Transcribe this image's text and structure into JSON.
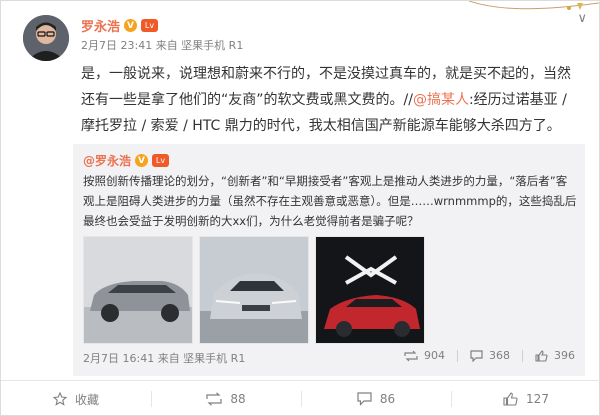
{
  "post": {
    "author": "罗永浩",
    "verified_badge": "V",
    "level_badge": "Lv",
    "meta": "2月7日 23:41 来自 坚果手机 R1",
    "content_before": "是，一般说来，说理想和蔚来不行的，不是没摸过真车的，就是买不起的，当然还有一些是拿了他们的“友商”的软文费或黑文费的。//",
    "content_mention": "@搞某人",
    "content_after": ":经历过诺基亚 / 摩托罗拉 / 索爱 / HTC 鼎力的时代，我太相信国产新能源车能够大杀四方了。"
  },
  "repost": {
    "author": "@罗永浩",
    "text": "按照创新传播理论的划分，“创新者”和“早期接受者”客观上是推动人类进步的力量，“落后者”客观上是阻碍人类进步的力量（虽然不存在主观善意或恶意）。但是……wrnmmmp的，这些捣乱后最终也会受益于发明创新的大xx们，为什么老觉得前者是骗子呢？",
    "meta": "2月7日 16:41 来自 坚果手机 R1",
    "reposts": "904",
    "comments": "368",
    "likes": "396",
    "photos": [
      "suv-silver-side",
      "suv-silver-front",
      "suv-red-lights"
    ]
  },
  "actions": {
    "favorite": "收藏",
    "repost": "88",
    "comment": "86",
    "like": "127"
  },
  "colors": {
    "accent": "#eb7350",
    "muted": "#808080",
    "repost_bg": "#f2f2f5"
  }
}
